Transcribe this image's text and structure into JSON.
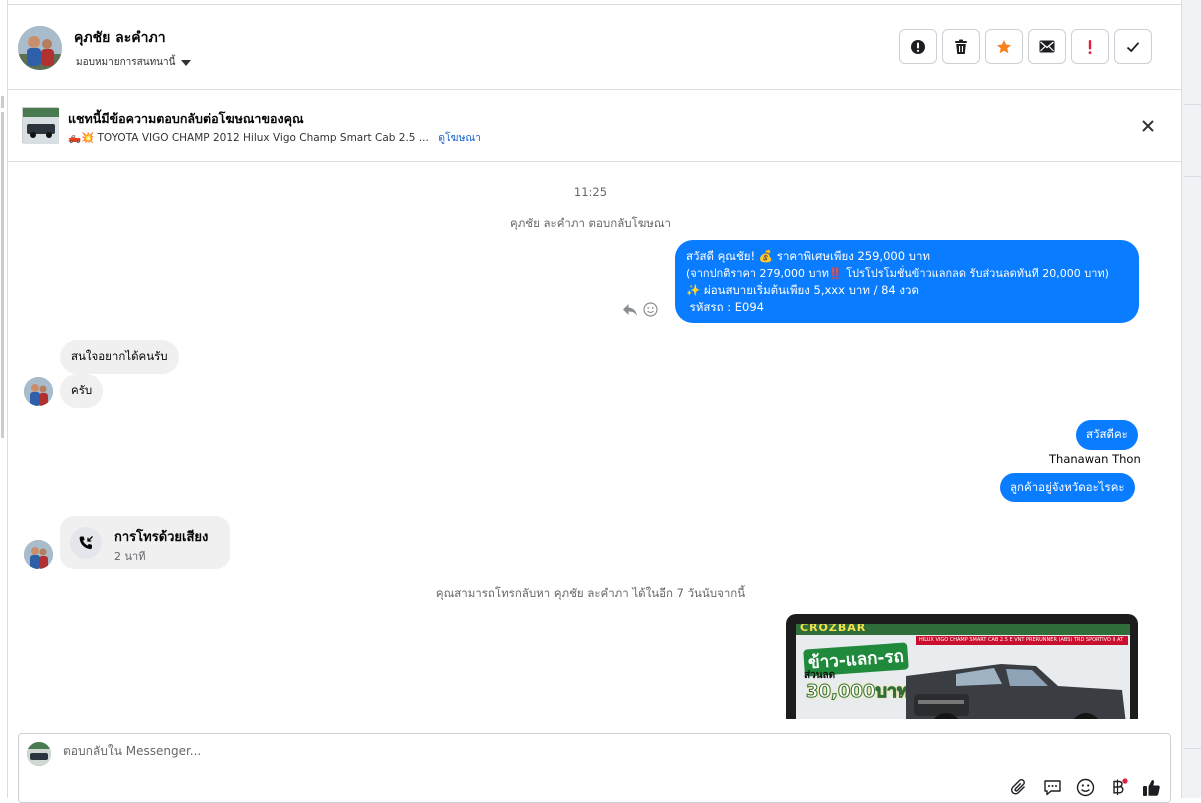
{
  "header": {
    "contact_name": "คุภชัย ละคำภา",
    "assign_label": "มอบหมายการสนทนานี้"
  },
  "actions": [
    {
      "name": "mark-spam-button",
      "icon": "alert-circle-icon"
    },
    {
      "name": "delete-button",
      "icon": "trash-icon"
    },
    {
      "name": "star-button",
      "icon": "star-icon",
      "color": "#f5821f"
    },
    {
      "name": "mark-unread-button",
      "icon": "envelope-icon"
    },
    {
      "name": "priority-button",
      "icon": "exclamation-icon",
      "color": "#e41e3f"
    },
    {
      "name": "mark-done-button",
      "icon": "check-icon"
    }
  ],
  "ad": {
    "title": "แชทนี้มีข้อความตอบกลับต่อโฆษณาของคุณ",
    "subtitle": "🛻💥 TOYOTA VIGO CHAMP 2012 Hilux Vigo Champ Smart Cab 2.5 ...",
    "link": "ดูโฆษณา"
  },
  "chat": {
    "time": "11:25",
    "reply_notice": "คุภชัย ละคำภา ตอบกลับโฆษณา",
    "outgoing_ad_message": [
      "สวัสดี คุณชัย! 💰 ราคาพิเศษเพียง 259,000 บาท",
      "(จากปกติราคา 279,000 บาท‼️ โปรโปรโมชั่นข้าวแลกลด รับส่วนลดทันที 20,000 บาท)",
      "✨ ผ่อนสบายเริ่มต้นเพียง 5,xxx บาท / 84 งวด",
      " รหัสรถ : E094"
    ],
    "incoming_1": "สนใจอยากได้คนรับ",
    "incoming_2": "ครับ",
    "outgoing_greeting": "สวัสดีคะ",
    "agent_name": "Thanawan Thon",
    "outgoing_question": "ลูกค้าอยู่จังหวัดอะไรคะ",
    "call_title": "การโทรด้วยเสียง",
    "call_duration": "2 นาที",
    "callback_notice": "คุณสามารถโทรกลับหา คุภชัย ละคำภา ได้ในอีก 7 วันนับจากนี้",
    "ad_image": {
      "brand": "CROZBAR",
      "headline": "ข้าว-แลก-รถ",
      "discount_label": "ส่วนลด",
      "discount_amount": "30,000บาท",
      "model_strip": "HILUX VIGO CHAMP SMART CAB 2.5 E VNT PRERUNNER (ABS) TRD SPORTIVO II AT"
    }
  },
  "composer": {
    "placeholder": "ตอบกลับใน Messenger..."
  },
  "colors": {
    "accent": "#0a7cff",
    "link": "#1763cf",
    "bubble_in": "#f0f0f0"
  }
}
